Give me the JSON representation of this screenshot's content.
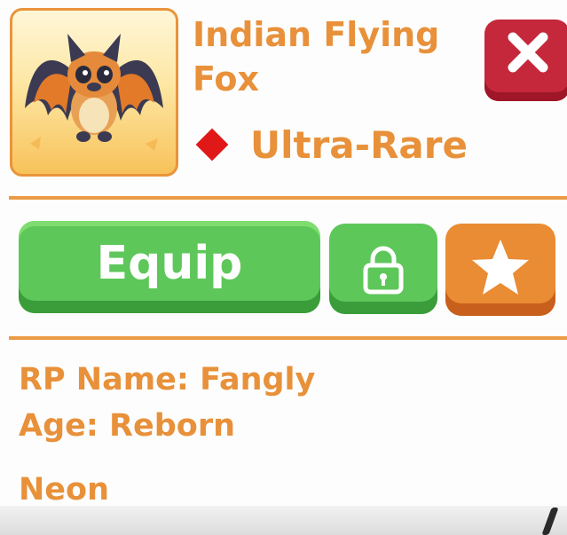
{
  "pet": {
    "name": "Indian Flying Fox",
    "rarity": "Ultra-Rare",
    "image_icon": "indian-flying-fox-bat-portrait",
    "rarity_icon": "red-diamond-icon"
  },
  "actions": {
    "equip_label": "Equip",
    "lock_icon": "lock-icon",
    "favorite_icon": "star-icon",
    "close_icon": "close-x-icon"
  },
  "details": {
    "rp_name": "RP Name: Fangly",
    "age": "Age: Reborn",
    "neon": "Neon"
  },
  "colors": {
    "accent_orange": "#e8913a",
    "equip_green": "#5ec75a",
    "close_red": "#c4283a",
    "rarity_red": "#e11818"
  }
}
